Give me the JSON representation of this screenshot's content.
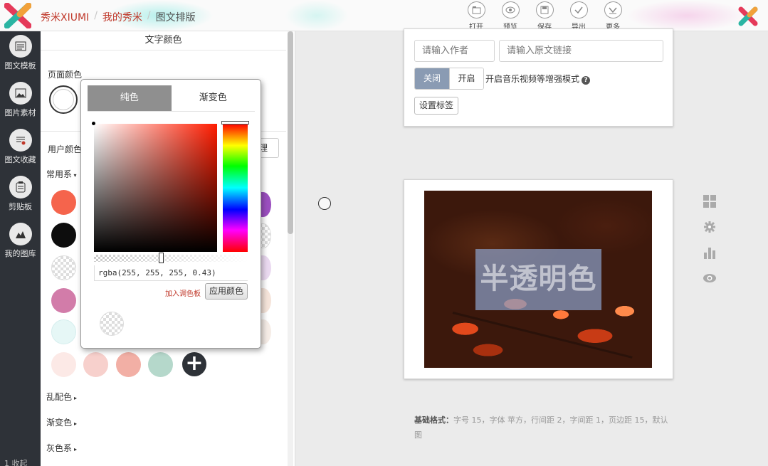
{
  "header": {
    "breadcrumbs": [
      "秀米XIUMI",
      "我的秀米",
      "图文排版"
    ],
    "toolbar": [
      {
        "icon": "open-icon",
        "label": "打开"
      },
      {
        "icon": "preview-icon",
        "label": "预览"
      },
      {
        "icon": "save-icon",
        "label": "保存"
      },
      {
        "icon": "export-icon",
        "label": "导出"
      },
      {
        "icon": "more-icon",
        "label": "更多"
      }
    ]
  },
  "sidebar": {
    "items": [
      {
        "icon": "template-icon",
        "label": "图文模板"
      },
      {
        "icon": "image-material-icon",
        "label": "图片素材"
      },
      {
        "icon": "favorites-icon",
        "label": "图文收藏"
      },
      {
        "icon": "clipboard-icon",
        "label": "剪贴板"
      },
      {
        "icon": "my-gallery-icon",
        "label": "我的图库"
      }
    ],
    "bottom_text": "1 收起"
  },
  "color_panel": {
    "title": "文字颜色",
    "page_color_label": "页面颜色",
    "user_color_label": "用户颜色",
    "manage_label": "理",
    "common_label": "常用系",
    "groups": [
      "乱配色",
      "渐变色",
      "灰色系"
    ],
    "swatches": [
      {
        "color": "#f5644c"
      },
      {
        "color": "#0d0d0d"
      },
      {
        "color": "transparent"
      },
      {
        "color": "#d27ca9"
      },
      {
        "color": "#e6f7f6"
      },
      {
        "color": "#fce9e6"
      },
      {
        "color": "#f7d0cc"
      },
      {
        "color": "#f2afa5"
      },
      {
        "color": "#b5d8cb"
      }
    ],
    "partial_right_colors": [
      "#9b4fbf",
      "transparent",
      "#ead9f0",
      "#f5e4da",
      "#f5ece6"
    ]
  },
  "picker": {
    "tabs": [
      "纯色",
      "渐变色"
    ],
    "active_tab": "纯色",
    "value": "rgba(255, 255, 255, 0.43)",
    "add_to_palette": "加入调色板",
    "apply": "应用颜色",
    "alpha": 0.43,
    "hue_color": "#ff1c00"
  },
  "editor": {
    "author_placeholder": "请输入作者",
    "link_placeholder": "请输入原文链接",
    "toggle_off": "关闭",
    "toggle_on": "开启",
    "enhanced_label": "开启音乐视频等增强模式",
    "tag_button": "设置标签",
    "overlay_text": "半透明色",
    "overlay_color": "#8aa0c8",
    "basic_format_label": "基础格式：",
    "basic_format_text": "字号 15，字体 苹方，行间距 2，字间距 1，页边距 15，默认图"
  },
  "side_tools": [
    "grid-icon",
    "gear-icon",
    "chart-icon",
    "eye-icon"
  ]
}
